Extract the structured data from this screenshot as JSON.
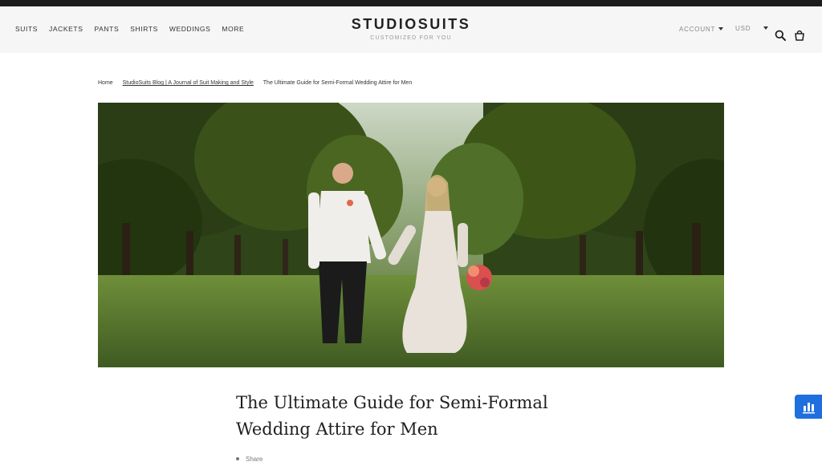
{
  "brand": {
    "name": "STUDIOSUITS",
    "tagline": "CUSTOMIZED FOR YOU"
  },
  "nav": {
    "items": [
      {
        "label": "SUITS"
      },
      {
        "label": "JACKETS"
      },
      {
        "label": "PANTS"
      },
      {
        "label": "SHIRTS"
      },
      {
        "label": "WEDDINGS"
      },
      {
        "label": "MORE"
      }
    ]
  },
  "header_right": {
    "account_label": "ACCOUNT",
    "currency_label": "USD",
    "search_icon": "search-icon",
    "cart_icon": "cart-icon"
  },
  "breadcrumb": {
    "home": "Home",
    "blog": "StudioSuits Blog | A Journal of Suit Making and Style",
    "current": "The Ultimate Guide for Semi-Formal Wedding Attire for Men"
  },
  "article": {
    "title": "The Ultimate Guide for Semi-Formal Wedding Attire for Men",
    "share_label": "Share"
  },
  "widget": {
    "icon": "chart-widget-icon",
    "color": "#1f6fde"
  }
}
